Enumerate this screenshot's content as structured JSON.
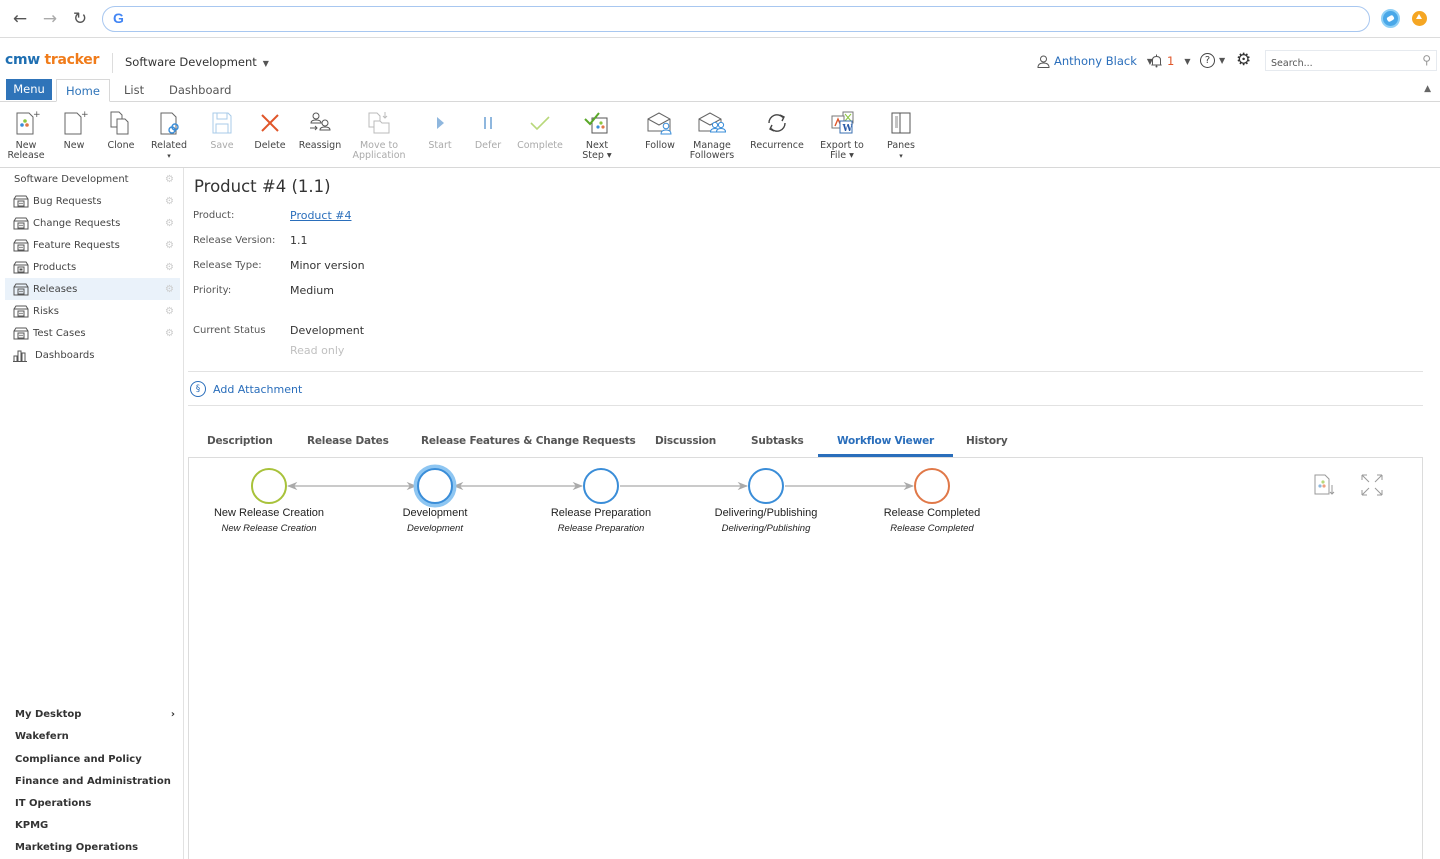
{
  "browser": {
    "back_icon": "arrow-left",
    "forward_icon": "arrow-right",
    "reload_icon": "reload",
    "address": ""
  },
  "header": {
    "logo_part1": "cmw",
    "logo_part2": "tracker",
    "workspace": "Software Development",
    "user_name": "Anthony Black",
    "notifications_count": "1",
    "help_glyph": "?",
    "search_placeholder": "Search..."
  },
  "top_tabs": {
    "menu": "Menu",
    "items": [
      "Home",
      "List",
      "Dashboard"
    ],
    "active": "Home"
  },
  "toolbar": {
    "buttons": [
      {
        "label1": "New",
        "label2": "Release",
        "icon": "new-release-icon",
        "enabled": true
      },
      {
        "label1": "New",
        "label2": "",
        "icon": "new-document-icon",
        "enabled": true
      },
      {
        "label1": "Clone",
        "label2": "",
        "icon": "clone-icon",
        "enabled": true
      },
      {
        "label1": "Related",
        "label2": "▾",
        "icon": "related-link-icon",
        "enabled": true
      },
      {
        "label1": "Save",
        "label2": "",
        "icon": "save-icon",
        "enabled": false
      },
      {
        "label1": "Delete",
        "label2": "",
        "icon": "delete-x-icon",
        "enabled": true
      },
      {
        "label1": "Reassign",
        "label2": "",
        "icon": "reassign-users-icon",
        "enabled": true
      },
      {
        "label1": "Move to",
        "label2": "Application",
        "icon": "move-folder-icon",
        "enabled": false
      },
      {
        "label1": "Start",
        "label2": "",
        "icon": "play-icon",
        "enabled": false
      },
      {
        "label1": "Defer",
        "label2": "",
        "icon": "pause-icon",
        "enabled": false
      },
      {
        "label1": "Complete",
        "label2": "",
        "icon": "checkmark-icon",
        "enabled": false
      },
      {
        "label1": "Next",
        "label2": "Step ▾",
        "icon": "next-step-icon",
        "enabled": true
      },
      {
        "label1": "Follow",
        "label2": "",
        "icon": "follow-envelope-icon",
        "enabled": true
      },
      {
        "label1": "Manage",
        "label2": "Followers",
        "icon": "manage-followers-icon",
        "enabled": true
      },
      {
        "label1": "Recurrence",
        "label2": "",
        "icon": "recurrence-icon",
        "enabled": true
      },
      {
        "label1": "Export to",
        "label2": "File ▾",
        "icon": "export-file-icon",
        "enabled": true
      },
      {
        "label1": "Panes",
        "label2": "▾",
        "icon": "panes-icon",
        "enabled": true
      }
    ]
  },
  "sidebar": {
    "root": "Software Development",
    "items": [
      {
        "label": "Bug Requests",
        "active": false
      },
      {
        "label": "Change Requests",
        "active": false
      },
      {
        "label": "Feature Requests",
        "active": false
      },
      {
        "label": "Products",
        "active": false
      },
      {
        "label": "Releases",
        "active": true
      },
      {
        "label": "Risks",
        "active": false
      },
      {
        "label": "Test Cases",
        "active": false
      }
    ],
    "dashboards": "Dashboards",
    "workspaces": [
      "My Desktop",
      "Wakefern",
      "Compliance and Policy",
      "Finance and Administration",
      "IT Operations",
      "KPMG",
      "Marketing Operations"
    ],
    "my_desktop_chevron": "›"
  },
  "record": {
    "title": "Product #4 (1.1)",
    "fields": [
      {
        "label": "Product:",
        "value": "Product #4",
        "link": true
      },
      {
        "label": "Release Version:",
        "value": "1.1",
        "link": false
      },
      {
        "label": "Release Type:",
        "value": "Minor version",
        "link": false
      },
      {
        "label": "Priority:",
        "value": "Medium",
        "link": false
      }
    ],
    "status_label": "Current Status",
    "status_value": "Development",
    "status_note": "Read only",
    "add_attachment": "Add Attachment"
  },
  "detail_tabs": {
    "items": [
      "Description",
      "Release Dates",
      "Release Features & Change Requests",
      "Discussion",
      "Subtasks",
      "Workflow Viewer",
      "History"
    ],
    "active": "Workflow Viewer"
  },
  "workflow": {
    "steps": [
      {
        "name": "New Release Creation",
        "sub": "New Release Creation",
        "color": "#a8c23a",
        "current": false
      },
      {
        "name": "Development",
        "sub": "Development",
        "color": "#3a8dd8",
        "current": true
      },
      {
        "name": "Release Preparation",
        "sub": "Release Preparation",
        "color": "#3a8dd8",
        "current": false
      },
      {
        "name": "Delivering/Publishing",
        "sub": "Delivering/Publishing",
        "color": "#3a8dd8",
        "current": false
      },
      {
        "name": "Release Completed",
        "sub": "Release Completed",
        "color": "#e07848",
        "current": false
      }
    ],
    "connector_color": "#aaaaaa",
    "highlight_color": "#8ec6f2"
  },
  "colors": {
    "accent": "#2f74b9",
    "link": "#2a6ebb",
    "logo_orange": "#f07c1b",
    "notification": "#e0562a"
  }
}
